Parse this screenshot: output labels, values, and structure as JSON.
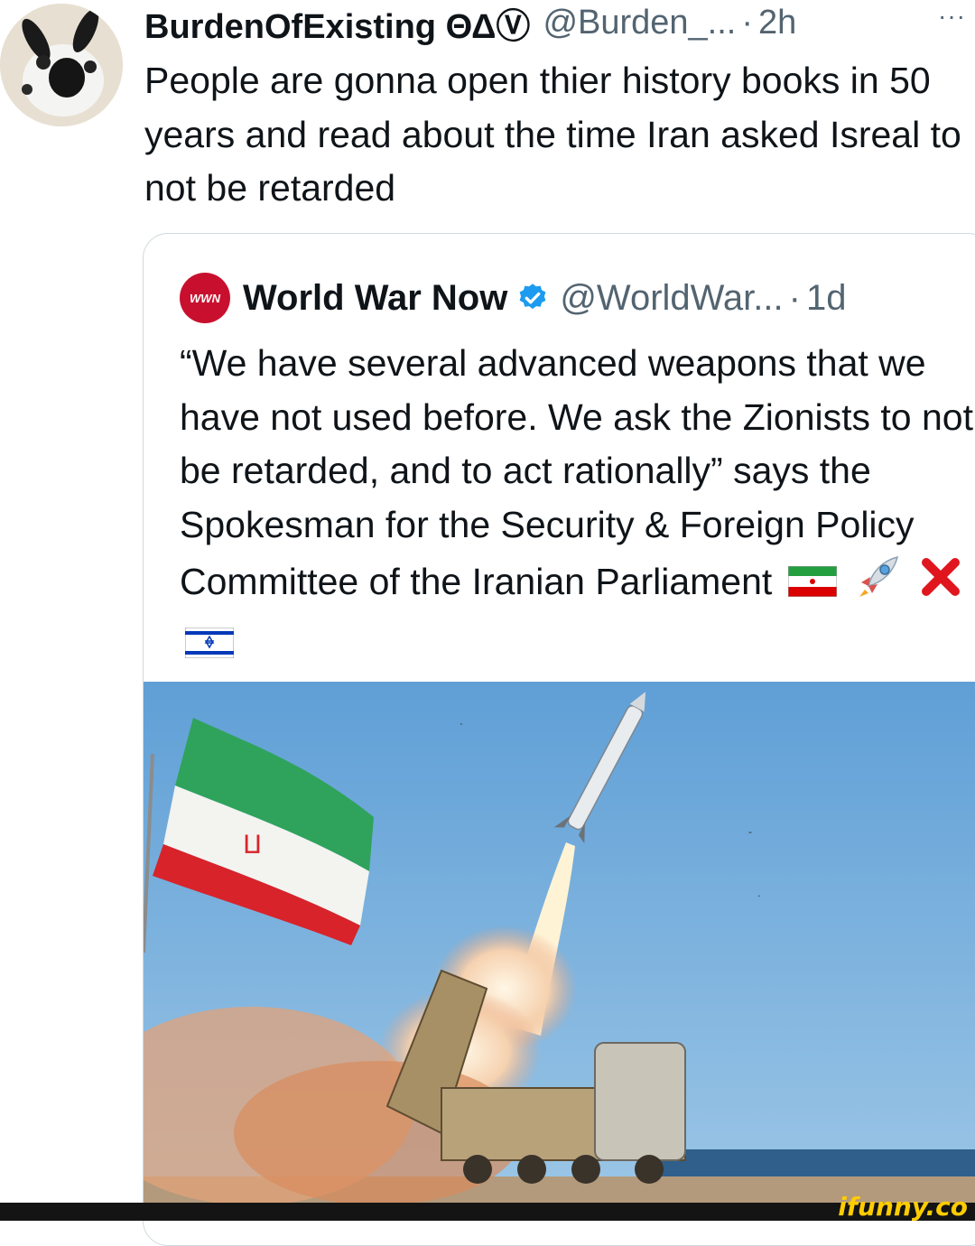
{
  "tweet": {
    "author_name": "BurdenOfExisting ΘΔⓋ",
    "handle": "@Burden_...",
    "separator": "·",
    "time": "2h",
    "more_label": "···",
    "text": "People are gonna open thier history books in 50 years and read about the time Iran asked Isreal to not be retarded"
  },
  "quoted": {
    "avatar_label": "WWN",
    "author_name": "World War Now",
    "handle": "@WorldWar...",
    "separator": "·",
    "time": "1d",
    "text": "“We have several advanced weapons that we have not used before. We ask the Zionists to not be retarded, and to act rationally” says the Spokesman for the Security & Foreign Policy Committee of the Iranian Parliament",
    "emojis": [
      "iran-flag-icon",
      "rocket-icon",
      "red-x-icon",
      "israel-flag-icon"
    ]
  },
  "watermark": {
    "text": "ifunny.co"
  },
  "colors": {
    "text_primary": "#0f1419",
    "text_secondary": "#536471",
    "verified_blue": "#1d9bf0",
    "border": "#cfd9de",
    "watermark": "#ffcc00"
  }
}
